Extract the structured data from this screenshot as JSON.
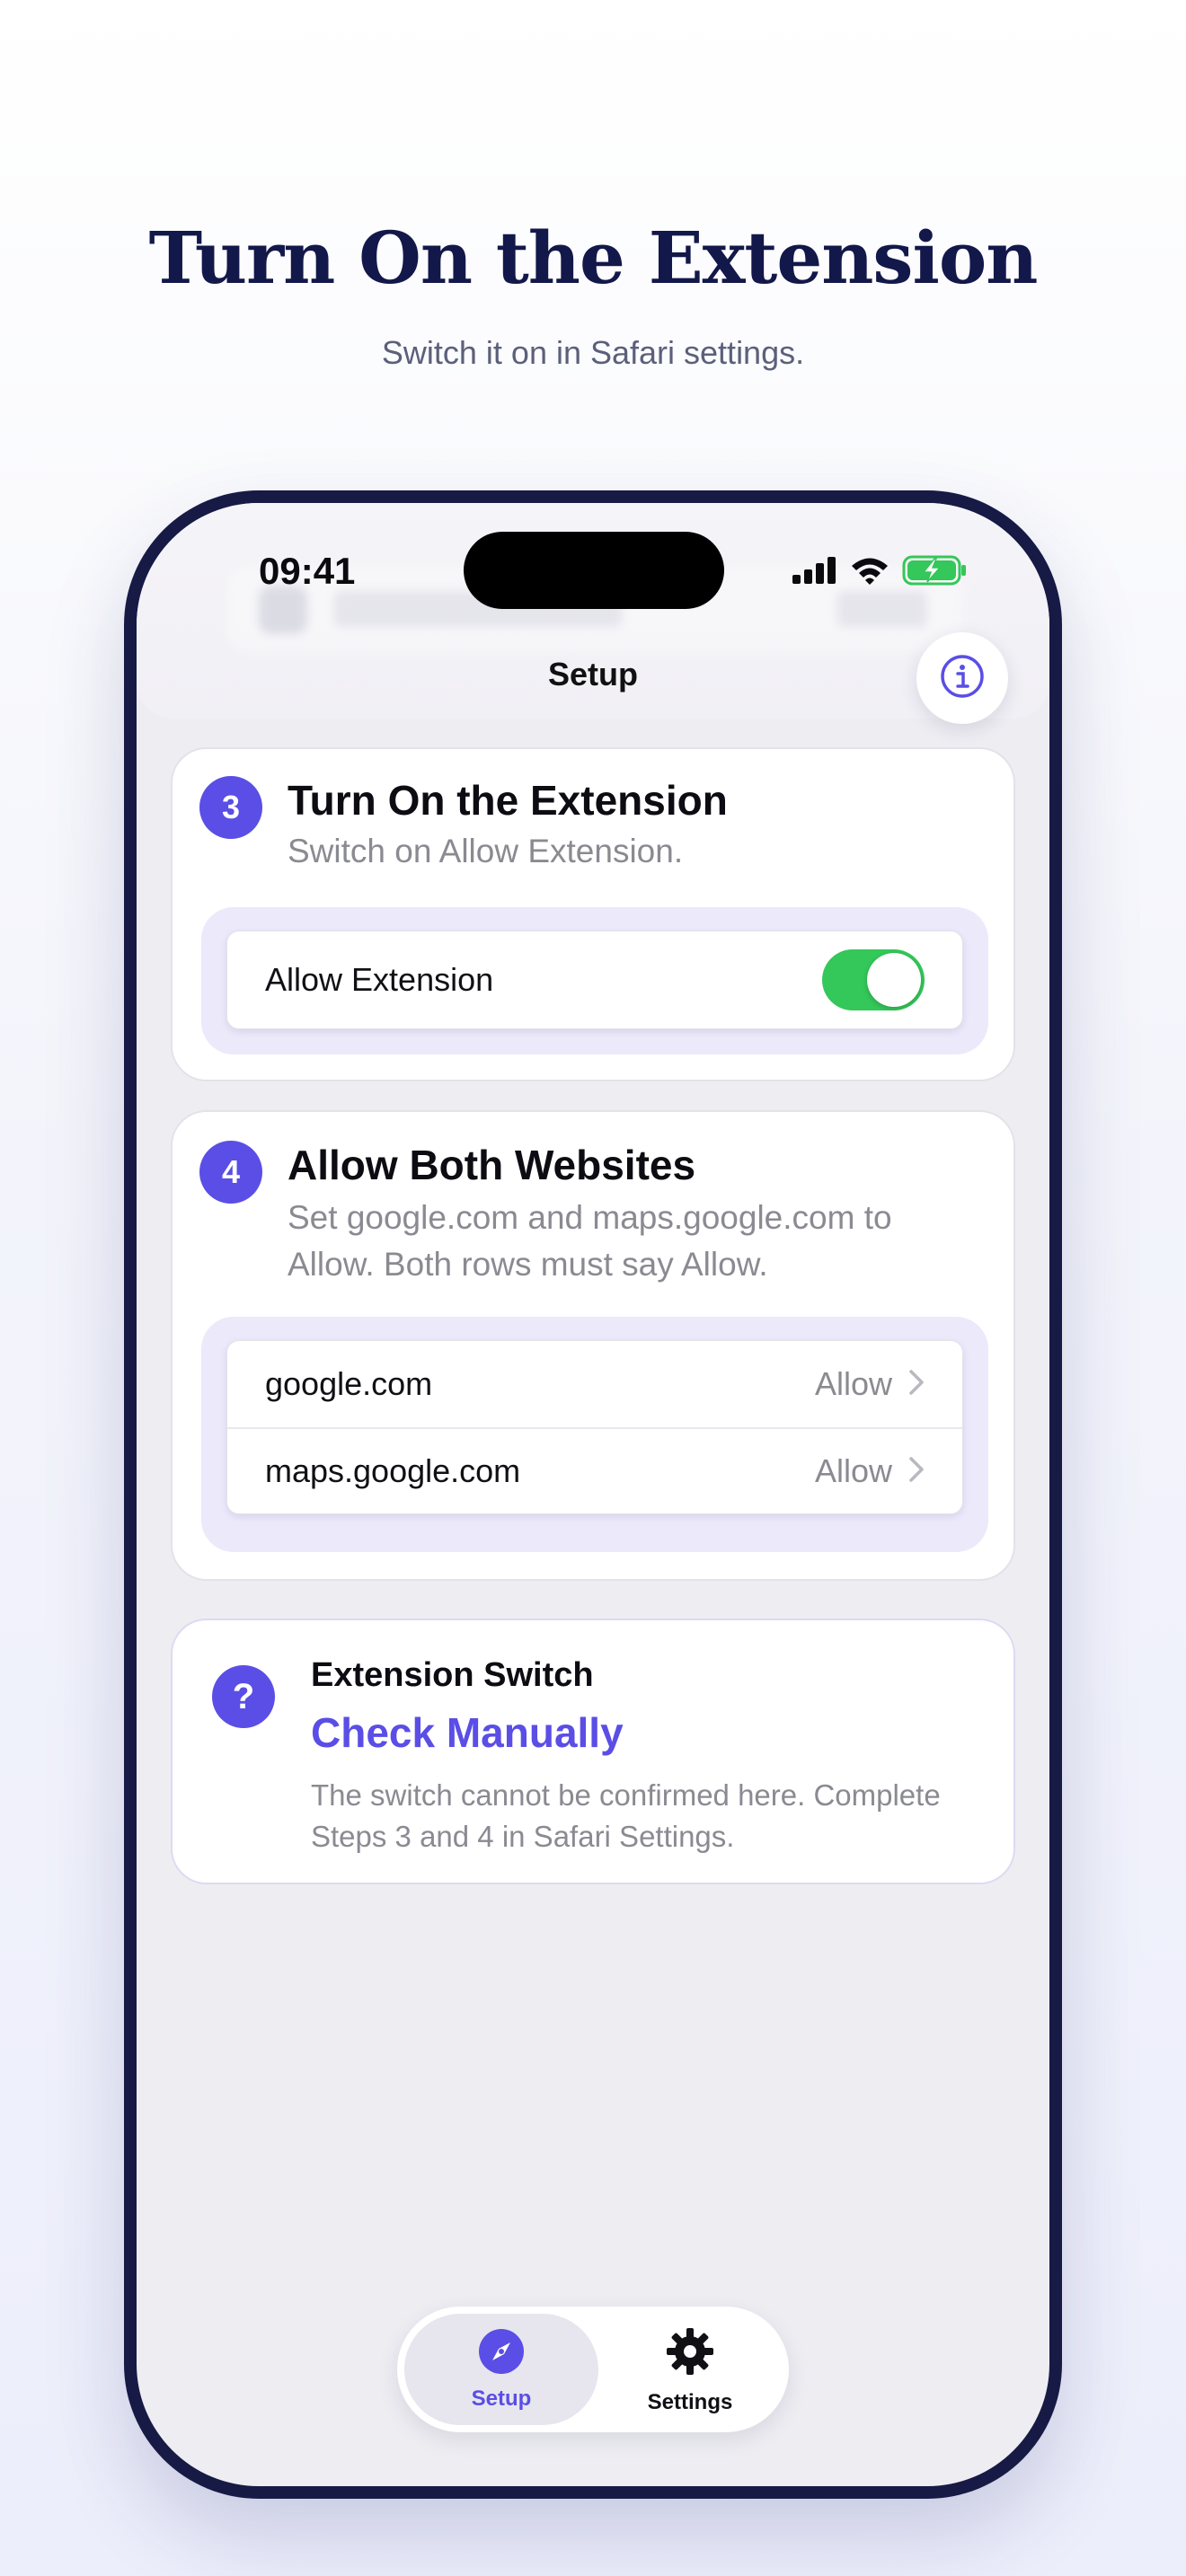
{
  "hero": {
    "title": "Turn On the Extension",
    "subtitle": "Switch it on in Safari settings."
  },
  "status_bar": {
    "time": "09:41",
    "icons": [
      "cellular-signal-icon",
      "wifi-icon",
      "battery-charging-icon"
    ]
  },
  "navbar": {
    "title": "Setup",
    "info_icon": "info-icon"
  },
  "step3": {
    "number": "3",
    "title": "Turn On the Extension",
    "description": "Switch on Allow Extension.",
    "row_label": "Allow Extension",
    "toggle_on": true
  },
  "step4": {
    "number": "4",
    "title": "Allow Both Websites",
    "description": "Set google.com and maps.google.com to Allow. Both rows must say Allow.",
    "rows": [
      {
        "label": "google.com",
        "value": "Allow"
      },
      {
        "label": "maps.google.com",
        "value": "Allow"
      }
    ]
  },
  "extension_switch": {
    "icon": "question-icon",
    "icon_glyph": "?",
    "title": "Extension Switch",
    "status": "Check Manually",
    "description": "The switch cannot be confirmed here. Complete Steps 3 and 4 in Safari Settings."
  },
  "tabbar": {
    "tabs": [
      {
        "label": "Setup",
        "icon": "compass-icon",
        "selected": true
      },
      {
        "label": "Settings",
        "icon": "gear-icon",
        "selected": false
      }
    ]
  },
  "colors": {
    "accent": "#5a4ee6",
    "toggle_on": "#34c759",
    "headline": "#13184a",
    "phone_frame": "#161a45"
  }
}
